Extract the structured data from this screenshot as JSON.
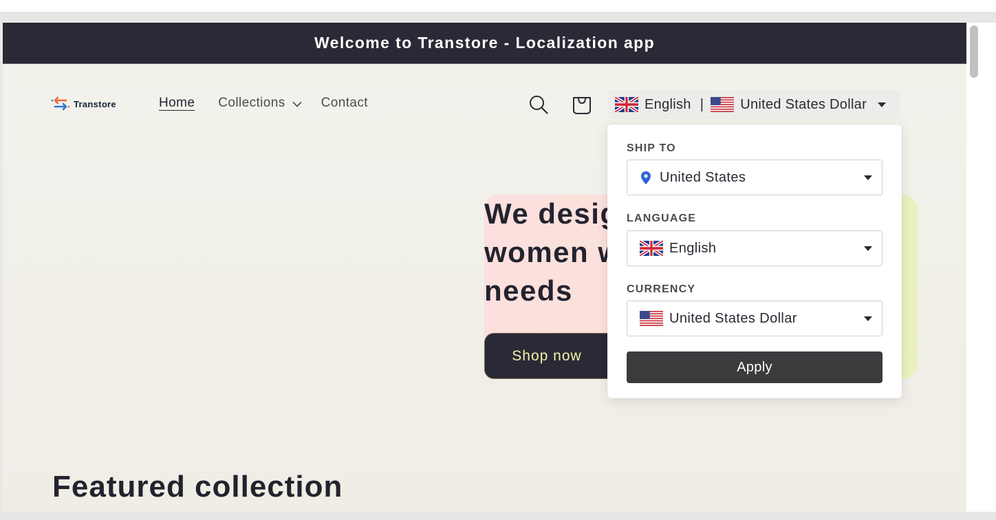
{
  "announcement": {
    "text": "Welcome to Transtore - Localization app"
  },
  "logo": {
    "text": "Transtore",
    "icon": "transtore-arrows-icon"
  },
  "nav": {
    "home": "Home",
    "collections": "Collections",
    "contact": "Contact"
  },
  "header_icons": [
    "search-icon",
    "cart-icon"
  ],
  "locale_switcher": {
    "language": "English",
    "separator": "|",
    "currency": "United States Dollar",
    "language_flag": "uk-flag-icon",
    "currency_flag": "us-flag-icon"
  },
  "popover": {
    "ship_to_label": "SHIP TO",
    "ship_to_value": "United States",
    "language_label": "LANGUAGE",
    "language_value": "English",
    "currency_label": "CURRENCY",
    "currency_value": "United States Dollar",
    "apply_label": "Apply"
  },
  "hero": {
    "title_lines": [
      "We desig",
      "women w",
      "needs"
    ],
    "cta_label": "Shop now"
  },
  "featured": {
    "title": "Featured collection"
  },
  "colors": {
    "announcement_bg": "#2a2a36",
    "cta_text": "#f3f3a8",
    "apply_bg": "#3b3b3e",
    "pin": "#2f63d6"
  }
}
